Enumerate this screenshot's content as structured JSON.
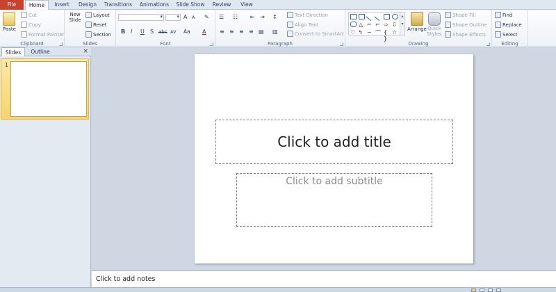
{
  "tabs": [
    {
      "label": "File"
    },
    {
      "label": "Home"
    },
    {
      "label": "Insert"
    },
    {
      "label": "Design"
    },
    {
      "label": "Transitions"
    },
    {
      "label": "Animations"
    },
    {
      "label": "Slide Show"
    },
    {
      "label": "Review"
    },
    {
      "label": "View"
    }
  ],
  "ribbon": {
    "clipboard": {
      "label": "Clipboard",
      "paste": "Paste",
      "cut": "Cut",
      "copy": "Copy",
      "format_painter": "Format Painter"
    },
    "slides": {
      "label": "Slides",
      "new_slide": "New Slide",
      "layout": "Layout",
      "reset": "Reset",
      "section": "Section"
    },
    "font": {
      "label": "Font",
      "bold": "B",
      "italic": "I",
      "underline": "U",
      "strike": "S",
      "strike2": "abc",
      "spacing": "AV",
      "case": "Aa",
      "color": "A",
      "grow": "A",
      "shrink": "A"
    },
    "paragraph": {
      "label": "Paragraph",
      "text_direction": "Text Direction",
      "align_text": "Align Text",
      "smartart": "Convert to SmartArt"
    },
    "drawing": {
      "label": "Drawing",
      "arrange": "Arrange",
      "quick_styles": "Quick Styles",
      "shape_fill": "Shape Fill",
      "shape_outline": "Shape Outline",
      "shape_effects": "Shape Effects"
    },
    "editing": {
      "label": "Editing",
      "find": "Find",
      "replace": "Replace",
      "select": "Select"
    }
  },
  "pane": {
    "tab_slides": "Slides",
    "tab_outline": "Outline",
    "close": "×",
    "slide_number": "1"
  },
  "slide": {
    "title_placeholder": "Click to add title",
    "subtitle_placeholder": "Click to add subtitle"
  },
  "notes": {
    "placeholder": "Click to add notes"
  },
  "colors": {
    "file_tab": "#c8432f",
    "ribbon_bg": "#fdfdfe",
    "thumb_highlight": "#f6d46e",
    "workspace": "#cfd7e2"
  }
}
